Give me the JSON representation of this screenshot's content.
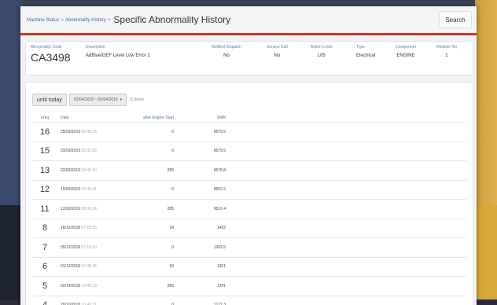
{
  "breadcrumb": {
    "items": [
      "Machine Status",
      "Abnormality History"
    ],
    "current": "Specific Abnormality History"
  },
  "search_label": "Search",
  "summary": {
    "headers": {
      "code": "Abnormality Code",
      "description": "Description",
      "notified": "Notified Dispatch",
      "service_call": "Service Call",
      "action_level": "Action Level",
      "type": "Type",
      "component": "Component",
      "relative_no": "Relative No"
    },
    "values": {
      "code": "CA3498",
      "description": "AdBlue/DEF Level Low Error 2",
      "notified": "No",
      "service_call": "No",
      "action_level": "L05",
      "type": "Electrical",
      "component": "ENGINE",
      "relative_no": "1"
    }
  },
  "filter": {
    "until_today_label": "until today",
    "date_range": "02/04/2018 ~ 02/04/2019",
    "count": "11 items"
  },
  "table": {
    "headers": [
      "Freq",
      "Date",
      "after Engine Start",
      "SMR"
    ],
    "rows": [
      {
        "freq": "16",
        "date": "25/03/2019",
        "time": "06:48:35",
        "after": "0",
        "smr": "9579.5"
      },
      {
        "freq": "15",
        "date": "23/03/2019",
        "time": "05:32:25",
        "after": "0",
        "smr": "9579.5"
      },
      {
        "freq": "13",
        "date": "22/03/2019",
        "time": "23:40:30",
        "after": "285",
        "smr": "9578.8"
      },
      {
        "freq": "12",
        "date": "10/03/2019",
        "time": "23:48:41",
        "after": "0",
        "smr": "9552.5"
      },
      {
        "freq": "11",
        "date": "12/03/2019",
        "time": "08:35:24",
        "after": "285",
        "smr": "9512.4"
      },
      {
        "freq": "8",
        "date": "16/12/2018",
        "time": "07:18:33",
        "after": "34",
        "smr": "1422"
      },
      {
        "freq": "7",
        "date": "05/12/2018",
        "time": "07:18:10",
        "after": "0",
        "smr": "1302.5"
      },
      {
        "freq": "6",
        "date": "01/12/2018",
        "time": "07:48:35",
        "after": "93",
        "smr": "1301"
      },
      {
        "freq": "5",
        "date": "02/14/2018",
        "time": "14:48:18",
        "after": "285",
        "smr": "1241"
      },
      {
        "freq": "4",
        "date": "20/10/2018",
        "time": "10:48:31",
        "after": "0",
        "smr": "1177.3"
      }
    ]
  }
}
